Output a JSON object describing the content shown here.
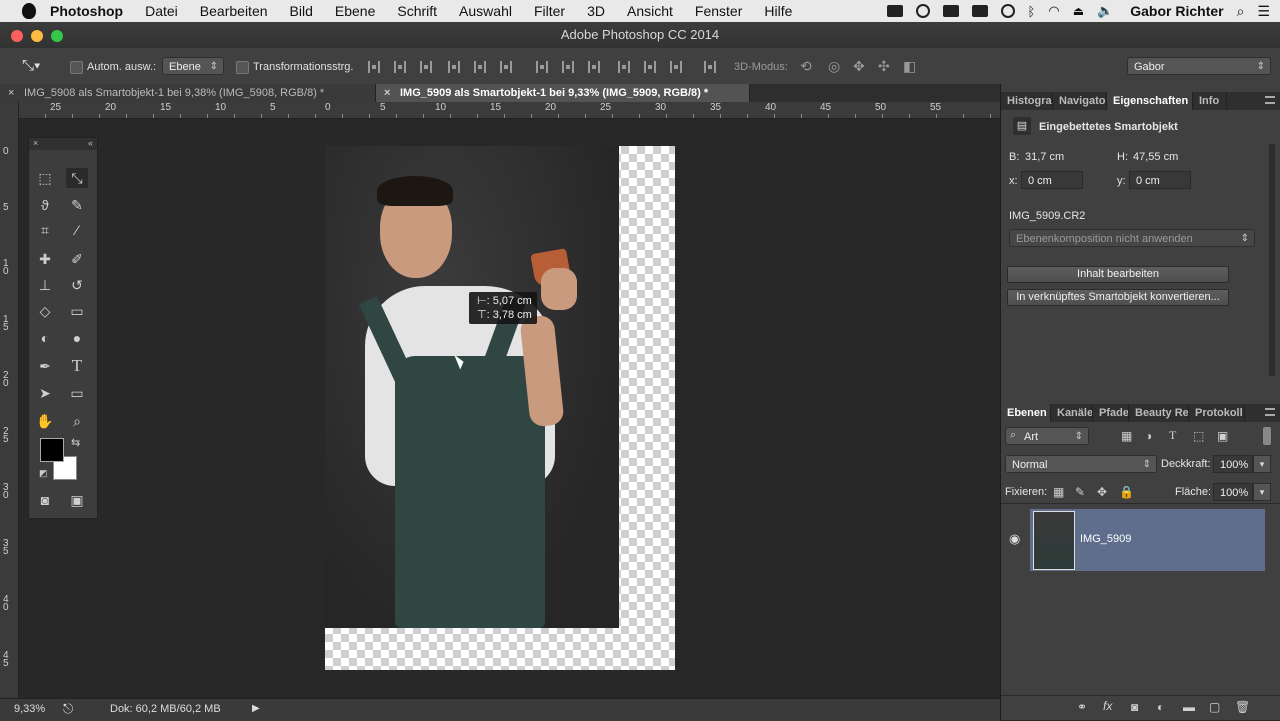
{
  "menubar": {
    "app": "Photoshop",
    "items": [
      "Datei",
      "Bearbeiten",
      "Bild",
      "Ebene",
      "Schrift",
      "Auswahl",
      "Filter",
      "3D",
      "Ansicht",
      "Fenster",
      "Hilfe"
    ],
    "user": "Gabor Richter"
  },
  "window": {
    "title": "Adobe Photoshop CC 2014"
  },
  "options": {
    "auto_select": "Autom. ausw.:",
    "auto_select_value": "Ebene",
    "transform": "Transformationsstrg.",
    "mode_3d": "3D-Modus:",
    "workspace": "Gabor"
  },
  "tabs": [
    {
      "label": "IMG_5908 als Smartobjekt-1 bei 9,38% (IMG_5908, RGB/8) *"
    },
    {
      "label": "IMG_5909 als Smartobjekt-1 bei 9,33% (IMG_5909, RGB/8) *"
    }
  ],
  "ruler": {
    "h": [
      "25",
      "20",
      "15",
      "10",
      "5",
      "0",
      "5",
      "10",
      "15",
      "20",
      "25",
      "30",
      "35",
      "40",
      "45",
      "50",
      "55"
    ],
    "v": [
      "0",
      "5",
      "10",
      "15",
      "20",
      "25",
      "30",
      "35",
      "40",
      "45"
    ]
  },
  "measure": {
    "width": "⊢: 5,07 cm",
    "height": "⊤: 3,78 cm"
  },
  "status": {
    "zoom": "9,33%",
    "doc": "Dok: 60,2 MB/60,2 MB"
  },
  "properties": {
    "tabs": [
      "Histogra",
      "Navigato",
      "Eigenschaften",
      "Info"
    ],
    "heading": "Eingebettetes Smartobjekt",
    "w_label": "B:",
    "w_value": "31,7 cm",
    "h_label": "H:",
    "h_value": "47,55 cm",
    "x_label": "x:",
    "x_value": "0 cm",
    "y_label": "y:",
    "y_value": "0 cm",
    "filename": "IMG_5909.CR2",
    "comp": "Ebenenkomposition nicht anwenden",
    "edit_btn": "Inhalt bearbeiten",
    "convert_btn": "In verknüpftes Smartobjekt konvertieren..."
  },
  "layers": {
    "tabs": [
      "Ebenen",
      "Kanäle",
      "Pfade",
      "Beauty Ret",
      "Protokoll"
    ],
    "filter": "Art",
    "blend": "Normal",
    "opacity_label": "Deckkraft:",
    "opacity": "100%",
    "lock_label": "Fixieren:",
    "fill_label": "Fläche:",
    "fill": "100%",
    "layer_name": "IMG_5909"
  },
  "colors": {
    "accent_layer": "#5f6e8c",
    "panel": "#404040",
    "canvas": "#282828"
  }
}
